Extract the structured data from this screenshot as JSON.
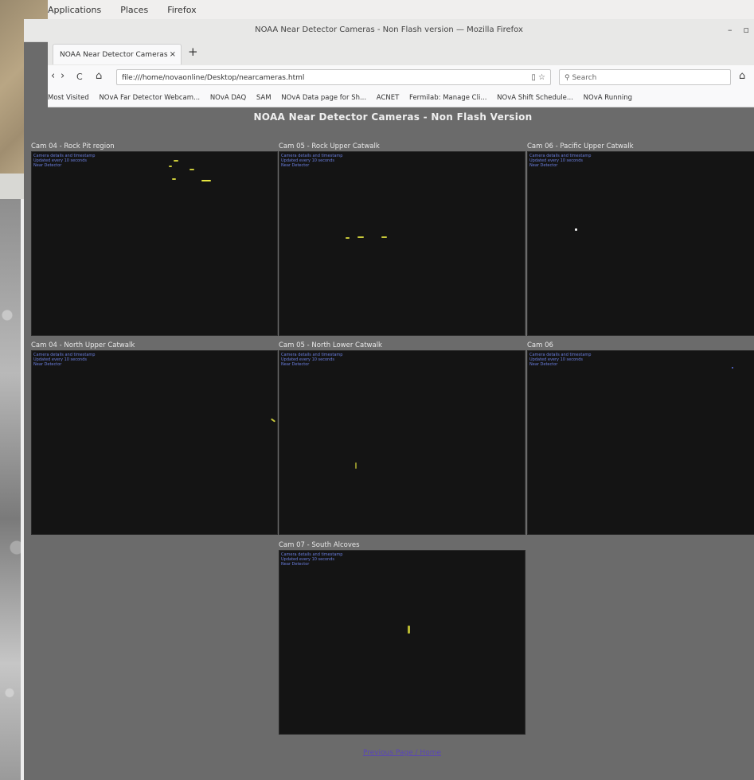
{
  "gnome": {
    "items": [
      "Applications",
      "Places",
      "Firefox"
    ]
  },
  "window": {
    "title": "NOAA Near Detector Cameras - Non Flash version — Mozilla Firefox",
    "controls": [
      "–",
      "▫"
    ]
  },
  "tab": {
    "label": "NOAA Near Detector Cameras",
    "close": "×",
    "new": "+"
  },
  "nav": {
    "back": "‹",
    "forward": "›",
    "reload": "C",
    "home": "⌂",
    "url": "file:///home/novaonline/Desktop/nearcameras.html",
    "search_placeholder": "Search"
  },
  "bookmarks": [
    "Most Visited",
    "NOvA Far Detector Webcam...",
    "NOvA DAQ",
    "SAM",
    "NOvA Data page for Sh...",
    "ACNET",
    "Fermilab: Manage Cli...",
    "NOvA Shift Schedule...",
    "NOvA Running"
  ],
  "page": {
    "title": "NOAA Near Detector Cameras - Non Flash Version",
    "footer_link": "Previous Page / Home"
  },
  "cameras": [
    {
      "label": "Cam 04 - Rock Pit region",
      "overlay": "Camera details and timestamp\nUpdated every 10 seconds\nNear Detector"
    },
    {
      "label": "Cam 05 - Rock Upper Catwalk",
      "overlay": "Camera details and timestamp\nUpdated every 10 seconds\nNear Detector"
    },
    {
      "label": "Cam 06 - Pacific Upper Catwalk",
      "overlay": "Camera details and timestamp\nUpdated every 10 seconds\nNear Detector"
    },
    {
      "label": "Cam 04 - North Upper Catwalk",
      "overlay": "Camera details and timestamp\nUpdated every 10 seconds\nNear Detector"
    },
    {
      "label": "Cam 05 - North Lower Catwalk",
      "overlay": "Camera details and timestamp\nUpdated every 10 seconds\nNear Detector"
    },
    {
      "label": "Cam 06",
      "overlay": "Camera details and timestamp\nUpdated every 10 seconds\nNear Detector"
    },
    {
      "label": "Cam 07 - South Alcoves",
      "overlay": "Camera details and timestamp\nUpdated every 10 seconds\nNear Detector"
    }
  ]
}
